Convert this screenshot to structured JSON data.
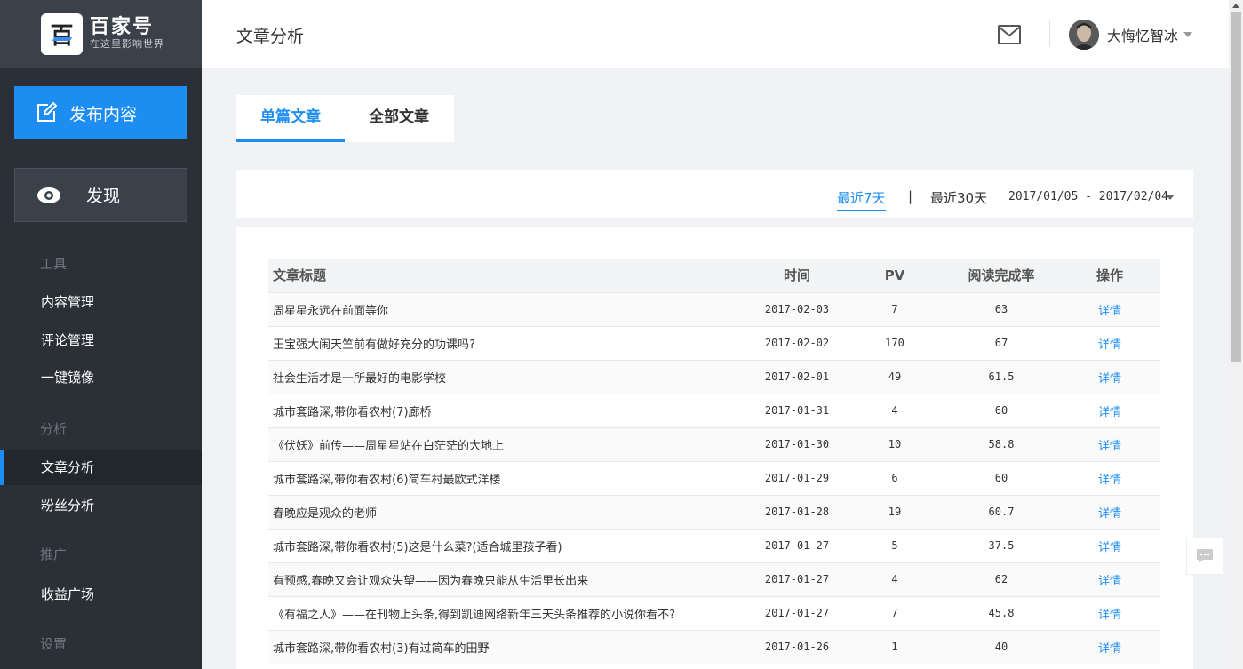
{
  "sidebar": {
    "logo_glyph": "百",
    "brand": "百家号",
    "slogan": "在这里影响世界",
    "publish_label": "发布内容",
    "discover_label": "发现",
    "sections": {
      "tools": "工具",
      "analysis": "分析",
      "promotion": "推广",
      "settings": "设置"
    },
    "items": {
      "content_mgmt": "内容管理",
      "comment_mgmt": "评论管理",
      "mirror": "一键镜像",
      "article_analysis": "文章分析",
      "fan_analysis": "粉丝分析",
      "revenue": "收益广场"
    }
  },
  "header": {
    "title": "文章分析",
    "user_name": "大悔忆智冰"
  },
  "tabs": {
    "single": "单篇文章",
    "all": "全部文章"
  },
  "filter": {
    "last7": "最近7天",
    "separator": "|",
    "last30": "最近30天",
    "date_range": "2017/01/05 - 2017/02/04"
  },
  "table": {
    "headers": {
      "title": "文章标题",
      "time": "时间",
      "pv": "PV",
      "completion": "阅读完成率",
      "action": "操作"
    },
    "rows": [
      {
        "title": "周星星永远在前面等你",
        "time": "2017-02-03",
        "pv": "7",
        "rate": "63",
        "action": "详情"
      },
      {
        "title": "王宝强大闹天竺前有做好充分的功课吗?",
        "time": "2017-02-02",
        "pv": "170",
        "rate": "67",
        "action": "详情"
      },
      {
        "title": "社会生活才是一所最好的电影学校",
        "time": "2017-02-01",
        "pv": "49",
        "rate": "61.5",
        "action": "详情"
      },
      {
        "title": "城市套路深,带你看农村(7)廊桥",
        "time": "2017-01-31",
        "pv": "4",
        "rate": "60",
        "action": "详情"
      },
      {
        "title": "《伏妖》前传——周星星站在白茫茫的大地上",
        "time": "2017-01-30",
        "pv": "10",
        "rate": "58.8",
        "action": "详情"
      },
      {
        "title": "城市套路深,带你看农村(6)简车村最欧式洋楼",
        "time": "2017-01-29",
        "pv": "6",
        "rate": "60",
        "action": "详情"
      },
      {
        "title": "春晚应是观众的老师",
        "time": "2017-01-28",
        "pv": "19",
        "rate": "60.7",
        "action": "详情"
      },
      {
        "title": "城市套路深,带你看农村(5)这是什么菜?(适合城里孩子看)",
        "time": "2017-01-27",
        "pv": "5",
        "rate": "37.5",
        "action": "详情"
      },
      {
        "title": "有预感,春晚又会让观众失望——因为春晚只能从生活里长出来",
        "time": "2017-01-27",
        "pv": "4",
        "rate": "62",
        "action": "详情"
      },
      {
        "title": "《有福之人》——在刊物上头条,得到凯迪网络新年三天头条推荐的小说你看不?",
        "time": "2017-01-27",
        "pv": "7",
        "rate": "45.8",
        "action": "详情"
      },
      {
        "title": "城市套路深,带你看农村(3)有过简车的田野",
        "time": "2017-01-26",
        "pv": "1",
        "rate": "40",
        "action": "详情"
      }
    ]
  },
  "colors": {
    "accent": "#1e8df2",
    "sidebar_bg": "#2b3037",
    "page_bg": "#f0f2f5"
  }
}
